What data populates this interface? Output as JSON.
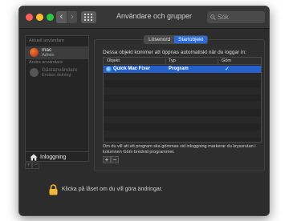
{
  "window": {
    "title": "Användare och grupper",
    "search_placeholder": "Sök"
  },
  "sidebar": {
    "current_users_header": "Aktuell användare",
    "current_user": {
      "name": "mac",
      "role": "Admin"
    },
    "other_users_header": "Andra användare",
    "guest_user": {
      "name": "Gästanvändare",
      "role": "Endast delning"
    },
    "login_options_label": "Inloggning",
    "add_label": "+",
    "remove_label": "−"
  },
  "tabs": [
    {
      "label": "Lösenord",
      "active": false
    },
    {
      "label": "Startobjekt",
      "active": true
    }
  ],
  "login_items": {
    "intro": "Dessa objekt kommer att öppnas automatiskt när du loggar in:",
    "columns": {
      "object": "Objekt",
      "type": "Typ",
      "hide": "Göm"
    },
    "rows": [
      {
        "object": "Quick Mac Fixer",
        "type": "Program",
        "hide": "✓",
        "selected": true
      }
    ],
    "help_text": "Om du vill att ett program ska gömmas vid inloggning markerar du kryssrutan i kolumnen Göm bredvid programmet.",
    "add_label": "+",
    "remove_label": "−"
  },
  "footer": {
    "lock_text": "Klicka på låset om du vill göra ändringar.",
    "help_label": "?"
  },
  "colors": {
    "accent": "#2661c9",
    "window_bg": "#2c2c2c",
    "lock": "#f2b53b"
  },
  "icons": [
    "search-icon",
    "grid-icon",
    "home-icon",
    "lock-icon",
    "app-icon",
    "checkmark-icon"
  ]
}
